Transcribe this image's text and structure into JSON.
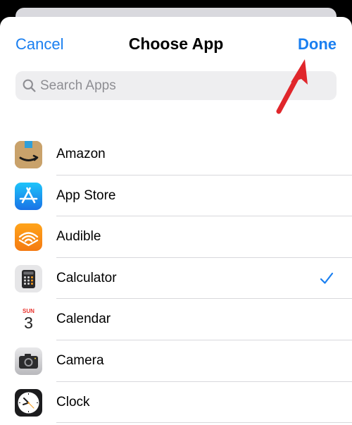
{
  "nav": {
    "cancel_label": "Cancel",
    "title": "Choose App",
    "done_label": "Done"
  },
  "search": {
    "placeholder": "Search Apps",
    "value": ""
  },
  "apps": [
    {
      "name": "Amazon",
      "icon": "amazon-app-icon",
      "selected": false
    },
    {
      "name": "App Store",
      "icon": "app-store-app-icon",
      "selected": false
    },
    {
      "name": "Audible",
      "icon": "audible-app-icon",
      "selected": false
    },
    {
      "name": "Calculator",
      "icon": "calculator-app-icon",
      "selected": true
    },
    {
      "name": "Calendar",
      "icon": "calendar-app-icon",
      "selected": false,
      "day": "SUN",
      "date": "3"
    },
    {
      "name": "Camera",
      "icon": "camera-app-icon",
      "selected": false
    },
    {
      "name": "Clock",
      "icon": "clock-app-icon",
      "selected": false
    }
  ],
  "colors": {
    "accent": "#1a7ff0",
    "annotation_arrow": "#e0262b"
  }
}
